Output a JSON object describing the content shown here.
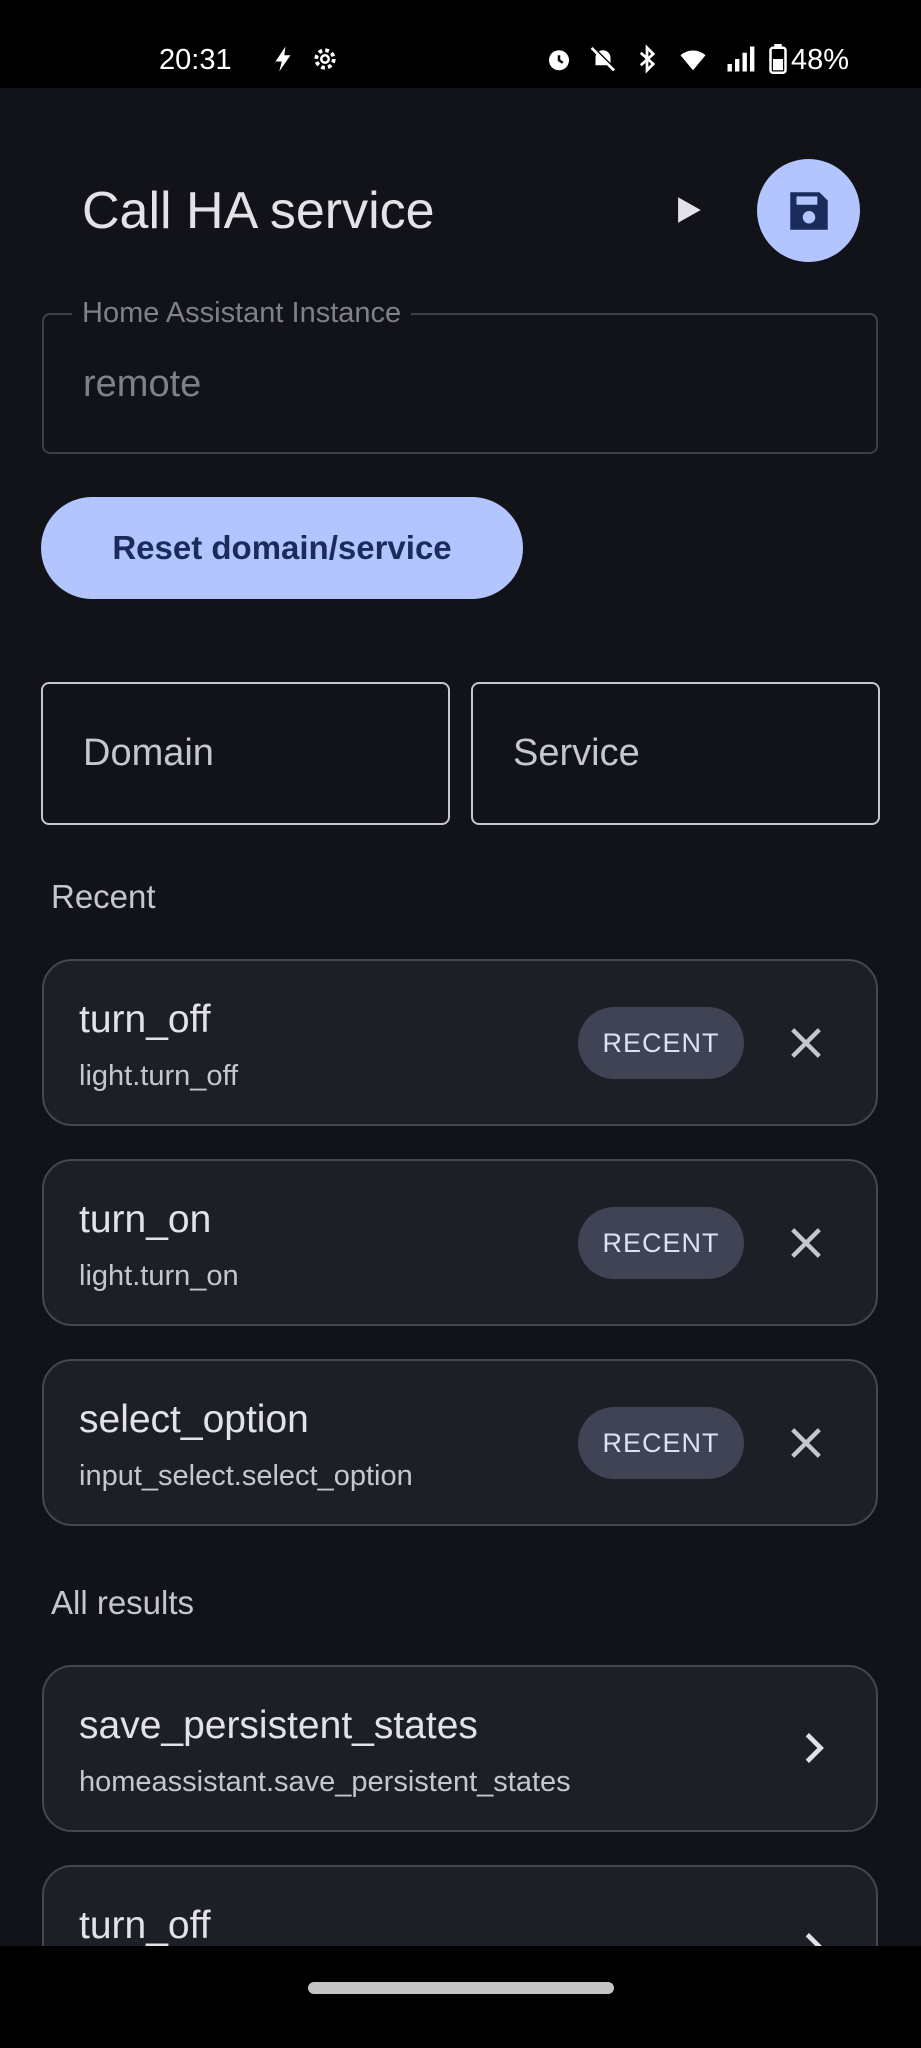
{
  "status_bar": {
    "time": "20:31",
    "battery": "48%"
  },
  "header": {
    "title": "Call HA service"
  },
  "instance": {
    "label": "Home Assistant Instance",
    "value": "remote"
  },
  "reset_label": "Reset domain/service",
  "fields": {
    "domain_placeholder": "Domain",
    "service_placeholder": "Service"
  },
  "recent": {
    "header": "Recent",
    "chip_label": "RECENT",
    "items": [
      {
        "name": "turn_off",
        "full": "light.turn_off"
      },
      {
        "name": "turn_on",
        "full": "light.turn_on"
      },
      {
        "name": "select_option",
        "full": "input_select.select_option"
      }
    ]
  },
  "all_results": {
    "header": "All results",
    "items": [
      {
        "name": "save_persistent_states",
        "full": "homeassistant.save_persistent_states"
      },
      {
        "name": "turn_off",
        "full": ""
      }
    ]
  },
  "colors": {
    "background": "#121318",
    "accent": "#b3c5ff",
    "card": "#1d1f26",
    "chip": "#3f4354"
  }
}
